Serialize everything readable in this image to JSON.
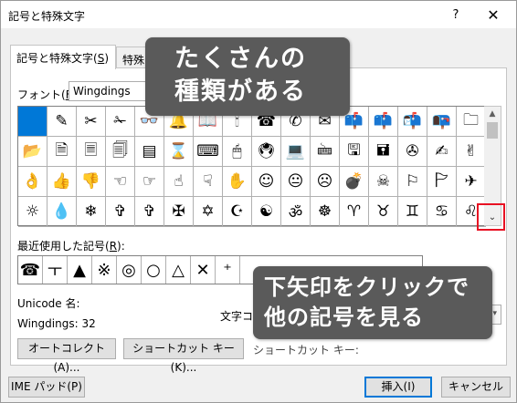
{
  "dialog": {
    "title": "記号と特殊文字",
    "help_label": "?",
    "close_label": "✕"
  },
  "tabs": [
    {
      "label": "記号と特殊文字(S)",
      "prefix": "記号と特殊文字(",
      "key": "S",
      "suffix": ")"
    },
    {
      "label": "特殊"
    }
  ],
  "font": {
    "label": "フォント(F):",
    "label_prefix": "フォント(",
    "label_key": "F",
    "label_suffix": "):",
    "value": "Wingdings"
  },
  "symbol_grid": {
    "rows": [
      [
        "▇",
        "✎",
        "✂",
        "✁",
        "👓",
        "🔔",
        "📖",
        "🕯",
        "☎",
        "✆",
        "✉",
        "📫",
        "📫",
        "📬",
        "📭",
        "🗀"
      ],
      [
        "📂",
        "🗎",
        "🗏",
        "🗐",
        "▤",
        "⌛",
        "⌨",
        "🖱",
        "🖲",
        "💻",
        "🖮",
        "🖫",
        "🖬",
        "✇",
        "✍",
        "✌"
      ],
      [
        "👌",
        "👍",
        "👎",
        "☜",
        "☞",
        "☝",
        "☟",
        "✋",
        "☺",
        "😐",
        "☹",
        "💣",
        "☠",
        "⚐",
        "🏱",
        "✈"
      ],
      [
        "☼",
        "💧",
        "❄",
        "✞",
        "✞",
        "✠",
        "✡",
        "☪",
        "☯",
        "ॐ",
        "☸",
        "♈",
        "♉",
        "♊",
        "♋",
        "♌"
      ],
      [
        "♍"
      ]
    ],
    "selected_index": 0
  },
  "scrollbar": {
    "up_arrow": "▲",
    "down_arrow": "⌄"
  },
  "recent": {
    "label": "最近使用した記号(R):",
    "label_prefix": "最近使用した記号(",
    "label_key": "R",
    "label_suffix": "):",
    "items": [
      "☎",
      "ㅜ",
      "▲",
      "※",
      "◎",
      "○",
      "△",
      "✕",
      "⁺"
    ]
  },
  "unicode_label": "Unicode 名:",
  "wingdings_code": "Wingdings: 32",
  "charcode_label": "文字コ",
  "buttons": {
    "autocorrect": "オートコレクト(A)...",
    "shortcut": "ショートカット キー(K)...",
    "ime_pad": "IME パッド(P)",
    "insert": "挿入(I)",
    "cancel": "キャンセル"
  },
  "shortcut_text": "ショートカット キー:",
  "callouts": {
    "top": [
      "たくさんの",
      "種類がある"
    ],
    "bottom": [
      "下矢印をクリックで",
      "他の記号を見る"
    ]
  }
}
